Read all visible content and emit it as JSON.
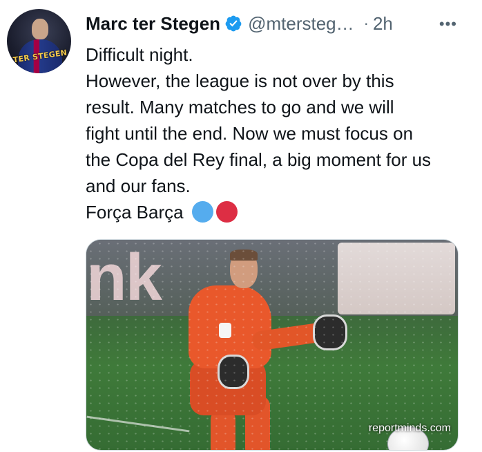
{
  "tweet": {
    "author_name": "Marc ter Stegen",
    "handle": "@mtersteg…",
    "separator": "·",
    "time": "2h",
    "more": "•••",
    "avatar_text": "TER STEGEN",
    "lines": [
      "Difficult night.",
      "However, the league is not over by this",
      "result. Many matches to go and we will",
      "fight until the end. Now we must focus on",
      "the Copa del Rey final, a big moment for us",
      "and our fans.",
      "Força Barça"
    ],
    "emojis": [
      "blue-circle",
      "red-circle"
    ],
    "colors": {
      "verified": "#1d9bf0",
      "text": "#0f1419",
      "secondary": "#536471",
      "emoji_blue": "#55acee",
      "emoji_red": "#dd2e44"
    }
  },
  "media": {
    "board_text": "nk",
    "watermark": "reportminds.com"
  }
}
